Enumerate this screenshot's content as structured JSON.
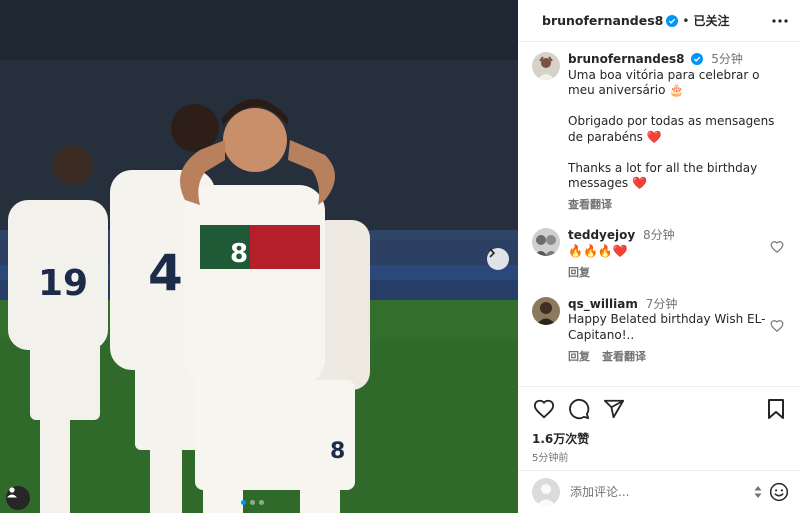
{
  "post": {
    "photo_alt": "",
    "carousel_dots": 3,
    "active_dot": 0
  },
  "header": {
    "username": "brunofernandes8",
    "separator": "•",
    "follow_state": "已关注"
  },
  "caption": {
    "username": "brunofernandes8",
    "time": "5分钟",
    "line1": "Uma boa vitória para celebrar o meu aniversário 🎂",
    "line2": "Obrigado por todas as mensagens de parabéns ❤️",
    "line3": "Thanks a lot for all the birthday messages ❤️",
    "see_translation": "查看翻译"
  },
  "comments": [
    {
      "username": "teddyejoy",
      "time": "8分钟",
      "text": "🔥🔥🔥❤️",
      "reply": "回复"
    },
    {
      "username": "qs_william",
      "time": "7分钟",
      "text": "Happy Belated birthday Wish EL-Capitano!..",
      "reply": "回复",
      "see_translation": "查看翻译"
    }
  ],
  "stats": {
    "likes": "1.6万次赞",
    "posted": "5分钟前"
  },
  "add_comment": {
    "placeholder": "添加评论..."
  },
  "colors": {
    "verified": "#0095f6",
    "heart": "#ed4956",
    "muted": "#737373"
  }
}
